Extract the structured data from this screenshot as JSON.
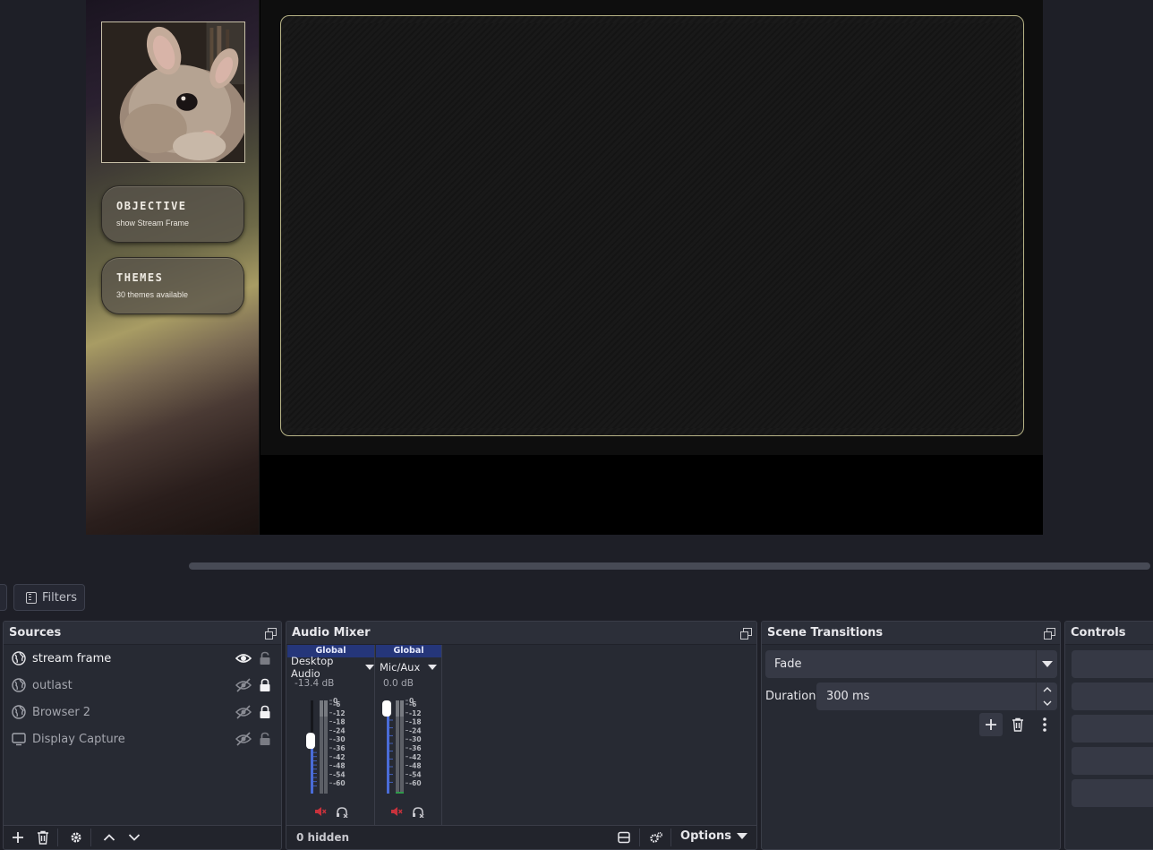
{
  "canvas": {
    "objective_card": {
      "title": "OBJECTIVE",
      "subtitle": "show Stream Frame"
    },
    "themes_card": {
      "title": "THEMES",
      "subtitle": "30 themes available"
    }
  },
  "toolbar": {
    "filters_label": "Filters"
  },
  "sources": {
    "title": "Sources",
    "items": [
      {
        "name": "stream frame",
        "icon": "globe-icon",
        "visible": true,
        "locked": false
      },
      {
        "name": "outlast",
        "icon": "globe-icon",
        "visible": false,
        "locked": true
      },
      {
        "name": "Browser 2",
        "icon": "globe-icon",
        "visible": false,
        "locked": true
      },
      {
        "name": "Display Capture",
        "icon": "monitor-icon",
        "visible": false,
        "locked": false
      }
    ]
  },
  "mixer": {
    "title": "Audio Mixer",
    "channels": [
      {
        "global": "Global",
        "name": "Desktop Audio",
        "db": "-13.4 dB",
        "volume_level": 0.58
      },
      {
        "global": "Global",
        "name": "Mic/Aux",
        "db": "0.0 dB",
        "volume_level": 1.0
      }
    ],
    "scale": [
      "0",
      "-6",
      "-12",
      "-18",
      "-24",
      "-30",
      "-36",
      "-42",
      "-48",
      "-54",
      "-60"
    ],
    "hidden_label": "0 hidden",
    "options_label": "Options"
  },
  "transitions": {
    "title": "Scene Transitions",
    "selected": "Fade",
    "duration_label": "Duration",
    "duration_value": "300 ms"
  },
  "controls": {
    "title": "Controls"
  },
  "colors": {
    "accent_blue": "#25367a",
    "frame_border": "#b7b386",
    "mute_red": "#c8323c"
  }
}
